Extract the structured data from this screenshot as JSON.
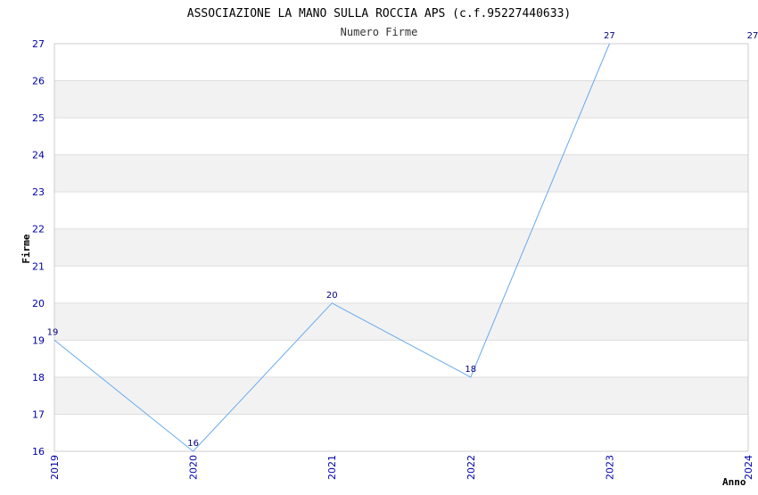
{
  "chart_data": {
    "type": "line",
    "title": "ASSOCIAZIONE LA MANO SULLA ROCCIA APS (c.f.95227440633)",
    "subtitle": "Numero Firme",
    "xlabel": "Anno",
    "ylabel": "Firme",
    "x": [
      "2019",
      "2020",
      "2021",
      "2022",
      "2023",
      "2024"
    ],
    "y_ticks": [
      "16",
      "17",
      "18",
      "19",
      "20",
      "21",
      "22",
      "23",
      "24",
      "25",
      "26",
      "27"
    ],
    "ylim": [
      16,
      27
    ],
    "series": [
      {
        "values": [
          19,
          16,
          20,
          18,
          27,
          27
        ],
        "drawn": [
          true,
          true,
          true,
          true,
          true,
          false
        ]
      }
    ],
    "data_labels": [
      "19",
      "16",
      "20",
      "18",
      "27",
      "27"
    ],
    "grid": true,
    "colors": {
      "line": "#66aaee",
      "band": "#f2f2f2",
      "grid": "#dddddd",
      "axis": "#cccccc",
      "tick_text": "#0000aa",
      "label_text": "#000080"
    }
  }
}
